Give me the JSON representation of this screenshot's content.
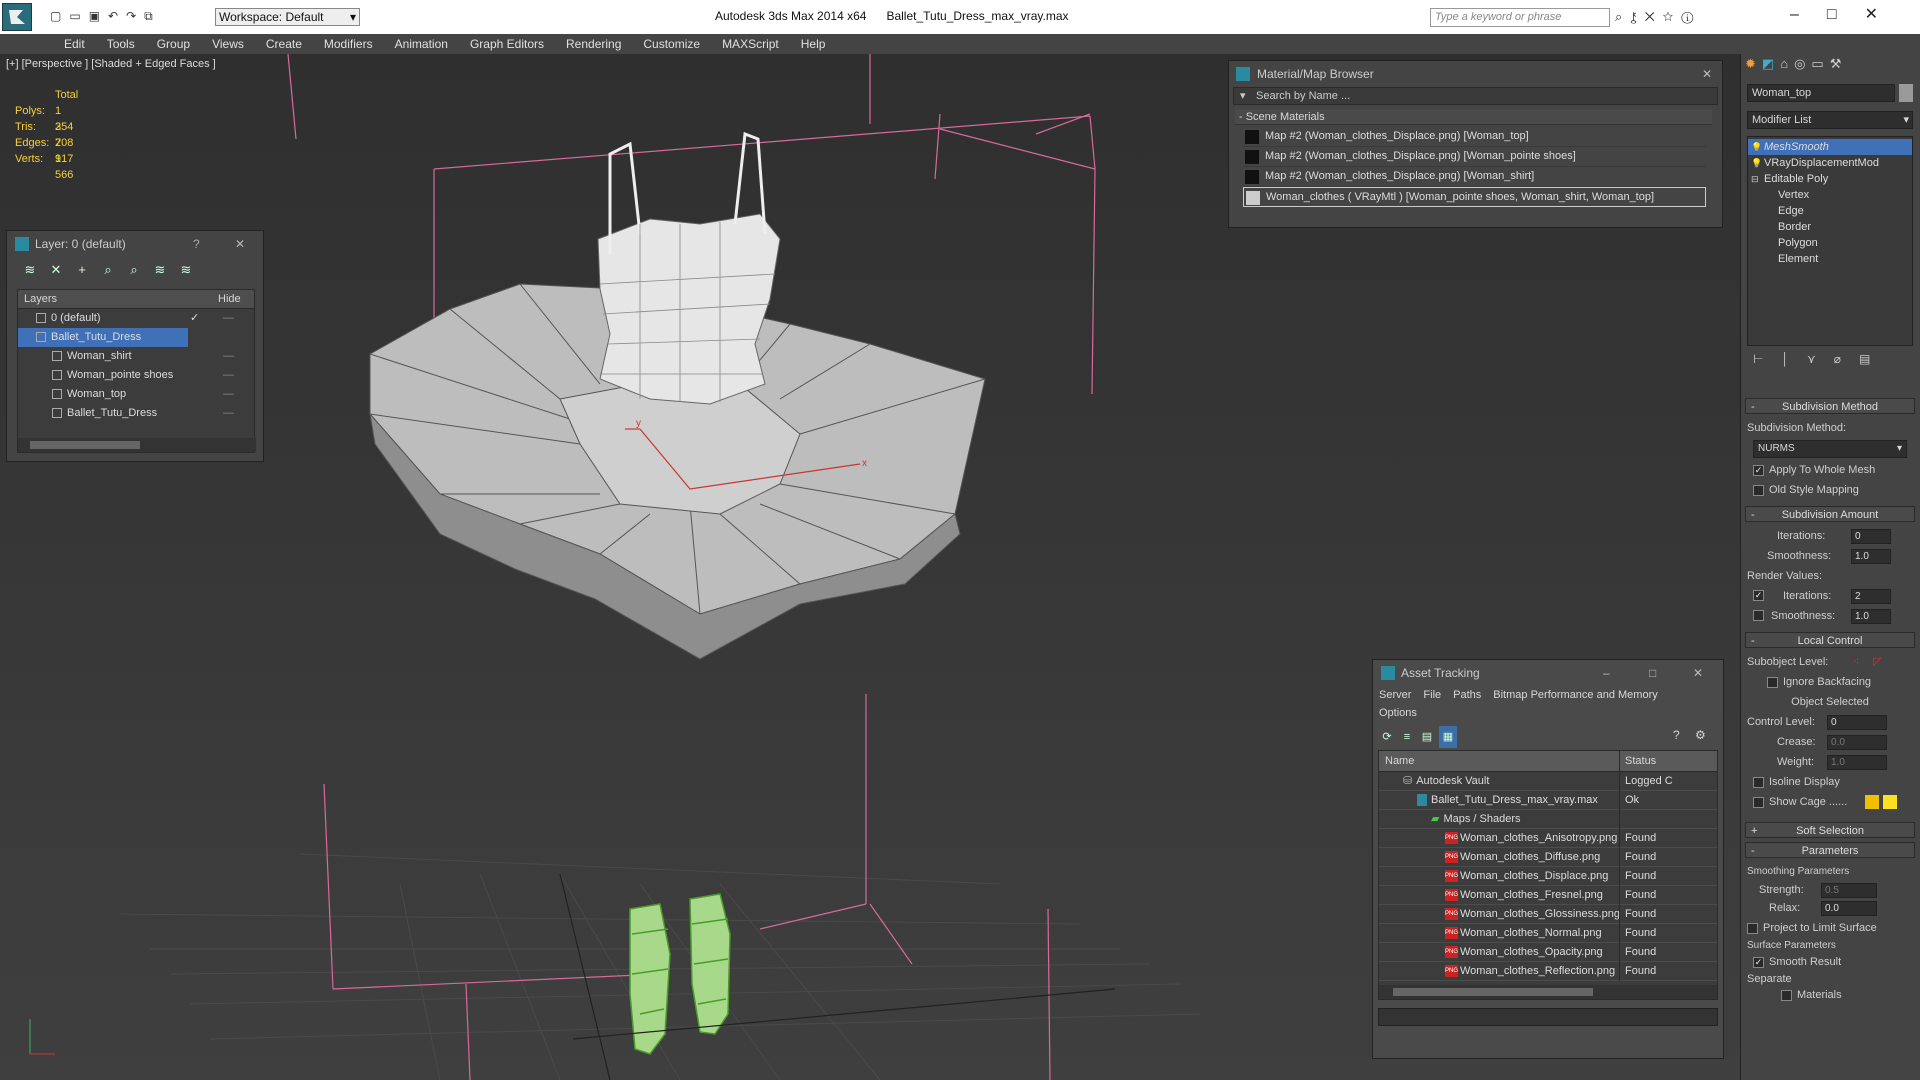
{
  "titlebar": {
    "app": "Autodesk 3ds Max  2014 x64",
    "file": "Ballet_Tutu_Dress_max_vray.max",
    "workspace": "Workspace: Default",
    "search_placeholder": "Type a keyword or phrase"
  },
  "menu": [
    "Edit",
    "Tools",
    "Group",
    "Views",
    "Create",
    "Modifiers",
    "Animation",
    "Graph Editors",
    "Rendering",
    "Customize",
    "MAXScript",
    "Help"
  ],
  "viewport": {
    "label": "[+] [Perspective ] [Shaded + Edged Faces ]",
    "stats": {
      "header": "Total",
      "rows": [
        {
          "k": "Polys:",
          "v": "1 354"
        },
        {
          "k": "Tris:",
          "v": "2 708"
        },
        {
          "k": "Edges:",
          "v": "2 917"
        },
        {
          "k": "Verts:",
          "v": "1 566"
        }
      ]
    },
    "axis_x": "x",
    "axis_y": "y"
  },
  "layer": {
    "title": "Layer: 0 (default)",
    "help": "?",
    "col_layers": "Layers",
    "col_hide": "Hide",
    "items": [
      {
        "label": "0 (default)",
        "indent": 1
      },
      {
        "label": "Ballet_Tutu_Dress",
        "indent": 1,
        "selected": true
      },
      {
        "label": "Woman_shirt",
        "indent": 2
      },
      {
        "label": "Woman_pointe shoes",
        "indent": 2
      },
      {
        "label": "Woman_top",
        "indent": 2
      },
      {
        "label": "Ballet_Tutu_Dress",
        "indent": 2
      }
    ]
  },
  "matbrowser": {
    "title": "Material/Map Browser",
    "search_placeholder": "Search by Name ...",
    "section": "- Scene Materials",
    "items": [
      "Map #2 (Woman_clothes_Displace.png) [Woman_top]",
      "Map #2 (Woman_clothes_Displace.png) [Woman_pointe shoes]",
      "Map #2 (Woman_clothes_Displace.png) [Woman_shirt]",
      "Woman_clothes  ( VRayMtl ) [Woman_pointe shoes, Woman_shirt, Woman_top]"
    ]
  },
  "asset": {
    "title": "Asset Tracking",
    "menu1": [
      "Server",
      "File",
      "Paths",
      "Bitmap Performance and Memory"
    ],
    "menu2": [
      "Options"
    ],
    "col_name": "Name",
    "col_status": "Status",
    "rows": [
      {
        "name": "Autodesk Vault",
        "status": "Logged C",
        "indent": 0,
        "icon": "vault"
      },
      {
        "name": "Ballet_Tutu_Dress_max_vray.max",
        "status": "Ok",
        "indent": 1,
        "icon": "max"
      },
      {
        "name": "Maps / Shaders",
        "status": "",
        "indent": 2,
        "icon": "maps"
      },
      {
        "name": "Woman_clothes_Anisotropy.png",
        "status": "Found",
        "indent": 3,
        "icon": "png"
      },
      {
        "name": "Woman_clothes_Diffuse.png",
        "status": "Found",
        "indent": 3,
        "icon": "png"
      },
      {
        "name": "Woman_clothes_Displace.png",
        "status": "Found",
        "indent": 3,
        "icon": "png"
      },
      {
        "name": "Woman_clothes_Fresnel.png",
        "status": "Found",
        "indent": 3,
        "icon": "png"
      },
      {
        "name": "Woman_clothes_Glossiness.png",
        "status": "Found",
        "indent": 3,
        "icon": "png"
      },
      {
        "name": "Woman_clothes_Normal.png",
        "status": "Found",
        "indent": 3,
        "icon": "png"
      },
      {
        "name": "Woman_clothes_Opacity.png",
        "status": "Found",
        "indent": 3,
        "icon": "png"
      },
      {
        "name": "Woman_clothes_Reflection.png",
        "status": "Found",
        "indent": 3,
        "icon": "png"
      }
    ],
    "png_badge": "PNG"
  },
  "cmd": {
    "object_name": "Woman_top",
    "modlist": "Modifier List",
    "stack": [
      {
        "label": "MeshSmooth",
        "italic": true,
        "indent": 0
      },
      {
        "label": "VRayDisplacementMod",
        "indent": 0
      },
      {
        "label": "Editable Poly",
        "indent": 0
      },
      {
        "label": "Vertex",
        "indent": 1
      },
      {
        "label": "Edge",
        "indent": 1
      },
      {
        "label": "Border",
        "indent": 1
      },
      {
        "label": "Polygon",
        "indent": 1
      },
      {
        "label": "Element",
        "indent": 1
      }
    ],
    "subdiv_method_title": "Subdivision Method",
    "subdiv_method_label": "Subdivision Method:",
    "subdiv_method_value": "NURMS",
    "apply_whole": "Apply To Whole Mesh",
    "old_style": "Old Style Mapping",
    "subdiv_amount_title": "Subdivision Amount",
    "iterations_label": "Iterations:",
    "iterations_value": "0",
    "smoothness_label": "Smoothness:",
    "smoothness_value": "1.0",
    "render_values": "Render Values:",
    "r_iterations_value": "2",
    "r_smoothness_value": "1.0",
    "local_title": "Local Control",
    "subobj_label": "Subobject Level:",
    "ignore_backfacing": "Ignore Backfacing",
    "object_selected": "Object Selected",
    "control_level_label": "Control Level:",
    "control_level_value": "0",
    "crease_label": "Crease:",
    "crease_value": "0.0",
    "weight_label": "Weight:",
    "weight_value": "1.0",
    "isoline": "Isoline Display",
    "show_cage": "Show Cage ......",
    "soft_sel_title": "Soft Selection",
    "params_title": "Parameters",
    "smoothing_params": "Smoothing Parameters",
    "strength_label": "Strength:",
    "strength_value": "0.5",
    "relax_label": "Relax:",
    "relax_value": "0.0",
    "project_limit": "Project to Limit Surface",
    "surface_params": "Surface Parameters",
    "smooth_result": "Smooth Result",
    "separate": "Separate",
    "materials": "Materials",
    "cage_color1": "#f0c000",
    "cage_color2": "#ffe020"
  }
}
